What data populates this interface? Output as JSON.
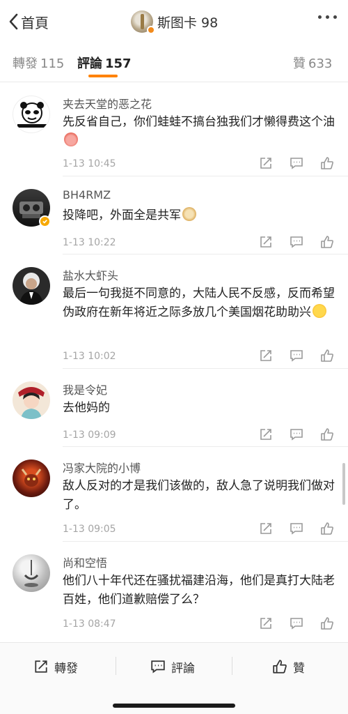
{
  "header": {
    "back_label": "首頁",
    "title": "斯图卡 98"
  },
  "tabs": [
    {
      "label": "轉發",
      "count": "115"
    },
    {
      "label": "評論",
      "count": "157"
    },
    {
      "label": "贊",
      "count": "633"
    }
  ],
  "comments": [
    {
      "user": "夹去天堂的恶之花",
      "text": "先反省自己，你们蛙蛙不搞台独我们才懒得费这个油",
      "time": "1-13 10:45",
      "emoji": "pig-head-emoji"
    },
    {
      "user": "BH4RMZ",
      "text": "投降吧，外面全是共军",
      "time": "1-13 10:22",
      "emoji": "doge-emoji",
      "verified": true
    },
    {
      "user": "盐水大虾头",
      "text": "最后一句我挺不同意的，大陆人民不反感，反而希望伪政府在新年将近之际多放几个美国烟花助助兴",
      "time": "1-13 10:02",
      "emoji": "tongue-wink-emoji"
    },
    {
      "user": "我是令妃",
      "text": "去他妈的",
      "time": "1-13 09:09"
    },
    {
      "user": "冯家大院的小博",
      "text": "敌人反对的才是我们该做的，敌人急了说明我们做对了。",
      "time": "1-13 09:05"
    },
    {
      "user": "尚和空悟",
      "text": "他们八十年代还在骚扰福建沿海，他们是真打大陆老百姓，他们道歉赔偿了么？",
      "time": "1-13 08:47"
    }
  ],
  "footer": {
    "repost_label": "轉發",
    "comment_label": "評論",
    "like_label": "贊"
  },
  "colors": {
    "accent": "#ff8200",
    "text": "#222222",
    "muted": "#a5a5a5"
  }
}
